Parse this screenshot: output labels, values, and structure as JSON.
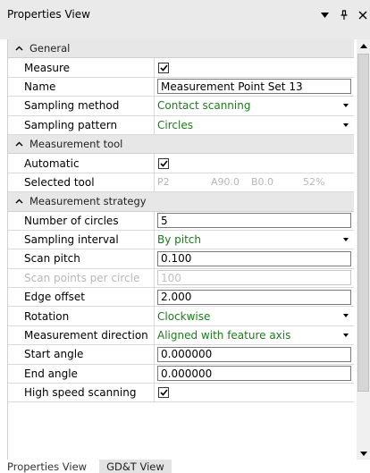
{
  "window": {
    "title": "Properties View"
  },
  "categories": {
    "general": "General",
    "tool": "Measurement tool",
    "strategy": "Measurement strategy"
  },
  "general": {
    "measure_label": "Measure",
    "name_label": "Name",
    "name_value": "Measurement Point Set 13",
    "sampling_method_label": "Sampling method",
    "sampling_method_value": "Contact scanning",
    "sampling_pattern_label": "Sampling pattern",
    "sampling_pattern_value": "Circles"
  },
  "tool": {
    "automatic_label": "Automatic",
    "selected_label": "Selected tool",
    "selected_p": "P2",
    "selected_a": "A90.0",
    "selected_b": "B0.0",
    "selected_pct": "52%"
  },
  "strategy": {
    "circles_label": "Number of circles",
    "circles_value": "5",
    "interval_label": "Sampling interval",
    "interval_value": "By pitch",
    "pitch_label": "Scan pitch",
    "pitch_value": "0.100",
    "points_label": "Scan points per circle",
    "points_value": "100",
    "edge_label": "Edge offset",
    "edge_value": "2.000",
    "rotation_label": "Rotation",
    "rotation_value": "Clockwise",
    "direction_label": "Measurement direction",
    "direction_value": "Aligned with feature axis",
    "start_label": "Start angle",
    "start_value": "0.000000",
    "end_label": "End angle",
    "end_value": "0.000000",
    "highspeed_label": "High speed scanning"
  },
  "tabs": [
    {
      "label": "Properties View",
      "active": true
    },
    {
      "label": "GD&T View",
      "active": false
    }
  ]
}
